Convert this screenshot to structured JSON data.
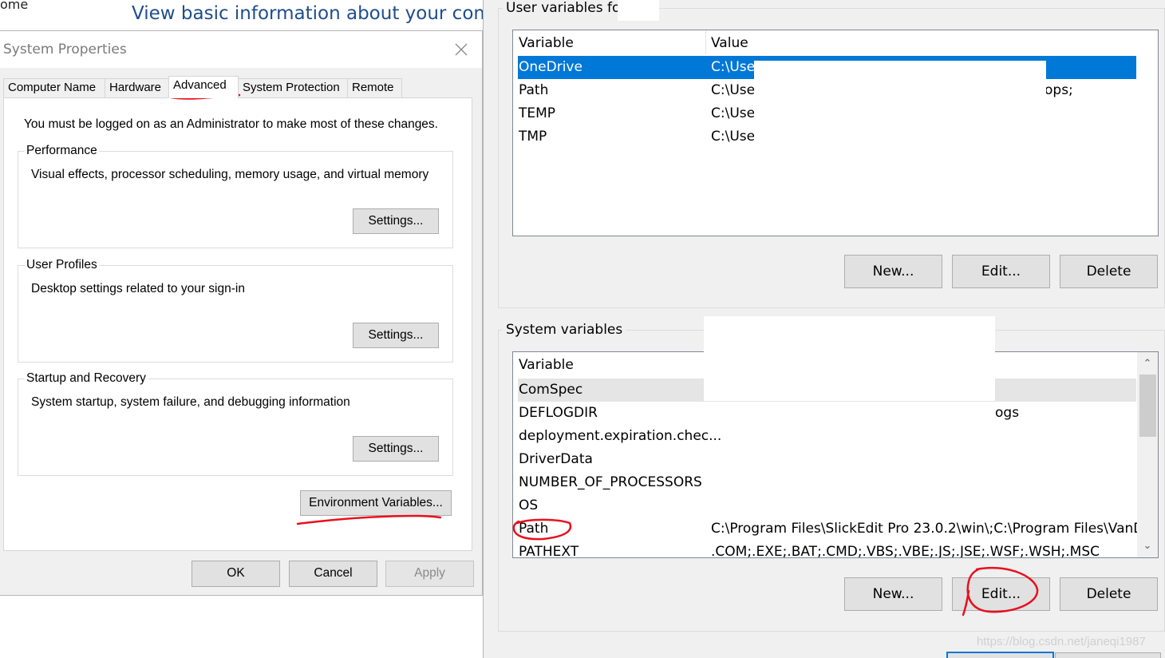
{
  "background_window": {
    "home_partial": "ome",
    "heading": "View basic information about your computer"
  },
  "system_properties": {
    "title": "System Properties",
    "tabs": [
      {
        "label": "Computer Name"
      },
      {
        "label": "Hardware"
      },
      {
        "label": "Advanced",
        "active": true
      },
      {
        "label": "System Protection"
      },
      {
        "label": "Remote"
      }
    ],
    "admin_note": "You must be logged on as an Administrator to make most of these changes.",
    "performance": {
      "title": "Performance",
      "description": "Visual effects, processor scheduling, memory usage, and virtual memory",
      "button": "Settings..."
    },
    "user_profiles": {
      "title": "User Profiles",
      "description": "Desktop settings related to your sign-in",
      "button": "Settings..."
    },
    "startup_recovery": {
      "title": "Startup and Recovery",
      "description": "System startup, system failure, and debugging information",
      "button": "Settings..."
    },
    "env_button": "Environment Variables...",
    "ok_button": "OK",
    "cancel_button": "Cancel",
    "apply_button": "Apply"
  },
  "environment_variables": {
    "user_section_label": "User variables for",
    "user_list": {
      "headers": {
        "variable": "Variable",
        "value": "Value"
      },
      "rows": [
        {
          "variable": "OneDrive",
          "value": "C:\\User",
          "selected": true
        },
        {
          "variable": "Path",
          "value": "C:\\User",
          "trailing": "ops;"
        },
        {
          "variable": "TEMP",
          "value": "C:\\User"
        },
        {
          "variable": "TMP",
          "value": "C:\\User"
        }
      ]
    },
    "user_buttons": {
      "new": "New...",
      "edit": "Edit...",
      "delete": "Delete"
    },
    "system_section_label": "System variables",
    "system_list": {
      "headers": {
        "variable": "Variable"
      },
      "rows": [
        {
          "variable": "ComSpec",
          "value": ""
        },
        {
          "variable": "DEFLOGDIR",
          "value": "",
          "trailing": "ogs"
        },
        {
          "variable": "deployment.expiration.chec...",
          "value": ""
        },
        {
          "variable": "DriverData",
          "value": ""
        },
        {
          "variable": "NUMBER_OF_PROCESSORS",
          "value": ""
        },
        {
          "variable": "OS",
          "value": ""
        },
        {
          "variable": "Path",
          "value": "C:\\Program Files\\SlickEdit Pro 23.0.2\\win\\;C:\\Program Files\\VanD..."
        },
        {
          "variable": "PATHEXT",
          "value": ".COM;.EXE;.BAT;.CMD;.VBS;.VBE;.JS;.JSE;.WSF;.WSH;.MSC"
        }
      ]
    },
    "system_buttons": {
      "new": "New...",
      "edit": "Edit...",
      "delete": "Delete"
    }
  },
  "watermark": "https://blog.csdn.net/janeqi1987",
  "colors": {
    "selection": "#0078d7",
    "annotation": "#e8101e",
    "heading_link": "#1e4e8c"
  }
}
